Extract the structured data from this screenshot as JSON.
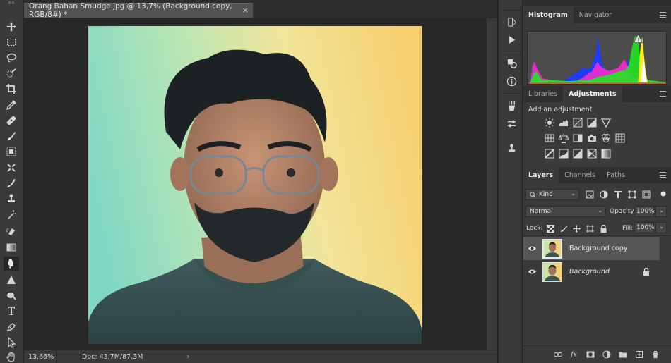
{
  "document": {
    "tab_title": "Orang Bahan Smudge.jpg @ 13,7% (Background copy, RGB/8#) *",
    "close_glyph": "×"
  },
  "status": {
    "zoom": "13,66%",
    "doc_size": "Doc: 43,7M/87,3M",
    "arrow": "›"
  },
  "histogram_panel": {
    "tabs": [
      "Histogram",
      "Navigator"
    ],
    "active_tab": "Histogram",
    "warning_glyph": "!"
  },
  "adjustments_panel": {
    "tabs": [
      "Libraries",
      "Adjustments"
    ],
    "active_tab": "Adjustments",
    "title": "Add an adjustment"
  },
  "layers_panel": {
    "tabs": [
      "Layers",
      "Channels",
      "Paths"
    ],
    "active_tab": "Layers",
    "filter_kind": "Kind",
    "blend_mode": "Normal",
    "opacity_label": "Opacity:",
    "opacity_value": "100%",
    "lock_label": "Lock:",
    "fill_label": "Fill:",
    "fill_value": "100%",
    "layers": [
      {
        "name": "Background copy",
        "selected": true,
        "locked": false,
        "italic": false
      },
      {
        "name": "Background",
        "selected": false,
        "locked": true,
        "italic": true
      }
    ],
    "footer_fx": "fx"
  },
  "colors": {
    "panel_bg": "#3a3a3a",
    "canvas_bg": "#282828",
    "selected_layer": "#565656",
    "photo_left": "#7fd8c4",
    "photo_right": "#f6cf6e"
  }
}
